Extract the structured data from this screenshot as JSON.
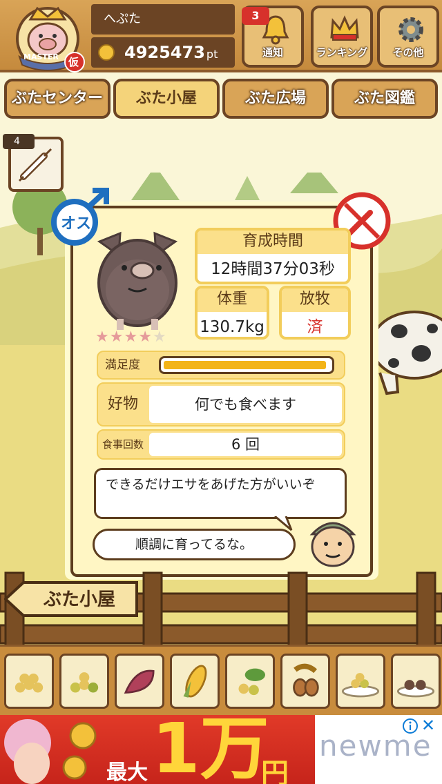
{
  "header": {
    "username": "へぷた",
    "points": "4925473",
    "points_unit": "pt",
    "badge_text": "MASTER",
    "temp_mark": "仮",
    "buttons": [
      {
        "label": "通知",
        "badge": "3",
        "icon": "bell-icon"
      },
      {
        "label": "ランキング",
        "icon": "crown-icon"
      },
      {
        "label": "その他",
        "icon": "gear-icon"
      }
    ]
  },
  "tabs": [
    "ぶたセンター",
    "ぶた小屋",
    "ぶた広場",
    "ぶた図鑑"
  ],
  "active_tab": "ぶた小屋",
  "side_item": {
    "count": "4",
    "icon": "syringe-icon"
  },
  "pig": {
    "gender_label": "オス",
    "rating": 4,
    "rating_max": 5,
    "growth_time_label": "育成時間",
    "growth_time": "12時間37分03秒",
    "weight_label": "体重",
    "weight": "130.7kg",
    "grazing_label": "放牧",
    "grazing": "済",
    "satisfaction_label": "満足度",
    "satisfaction_fraction": 0.98,
    "favorite_label": "好物",
    "favorite": "何でも食べます",
    "meals_label": "食事回数",
    "meals": "6 回"
  },
  "advice": {
    "message": "できるだけエサをあげた方がいいぞ",
    "comment": "順調に育ってるな。"
  },
  "location_sign": "ぶた小屋",
  "foods": [
    "soybeans-icon",
    "mixed-grain-icon",
    "sweet-potato-icon",
    "corn-icon",
    "vegetable-grain-icon",
    "acorn-icon",
    "grain-plate-icon",
    "meat-plate-icon"
  ],
  "ad": {
    "max_label": "最大",
    "amount": "1万",
    "yen": "円",
    "brand": "newme"
  },
  "colors": {
    "wood": "#c58a3d",
    "wood_dark": "#6b4424",
    "panel": "#fff6c4",
    "accent_yellow": "#f2cd5b",
    "ad_red": "#e13a28",
    "grazing_red": "#d7312b",
    "male_blue": "#1f6fbf"
  }
}
